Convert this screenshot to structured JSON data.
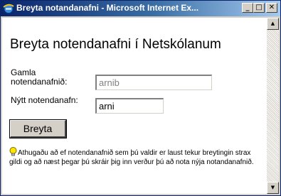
{
  "window": {
    "title": "Breyta notandanafni - Microsoft Internet Ex...",
    "controls": {
      "minimize": "_",
      "maximize": "□",
      "close": "✕"
    }
  },
  "icons": {
    "app": "ie-icon",
    "minimize": "minimize-icon",
    "maximize": "maximize-icon",
    "close": "close-icon",
    "notice": "lightbulb-icon"
  },
  "page": {
    "heading": "Breyta notendanafni í Netskólanum",
    "form": {
      "old_username_label": "Gamla notendanafnið:",
      "old_username_value": "arnib",
      "new_username_label": "Nýtt notendanafn:",
      "new_username_value": "arni",
      "submit_label": "Breyta"
    },
    "notice": "Athugaðu að ef notendanafnið sem þú valdir er laust tekur breytingin strax gildi og að næst þegar þú skráir þig inn verður þú að nota nýja notandanafnið."
  },
  "scrollbar": {
    "up": "▲",
    "down": "▼"
  },
  "colors": {
    "titlebar_start": "#0a246a",
    "titlebar_end": "#a6caf0",
    "chrome": "#d4d0c8"
  }
}
